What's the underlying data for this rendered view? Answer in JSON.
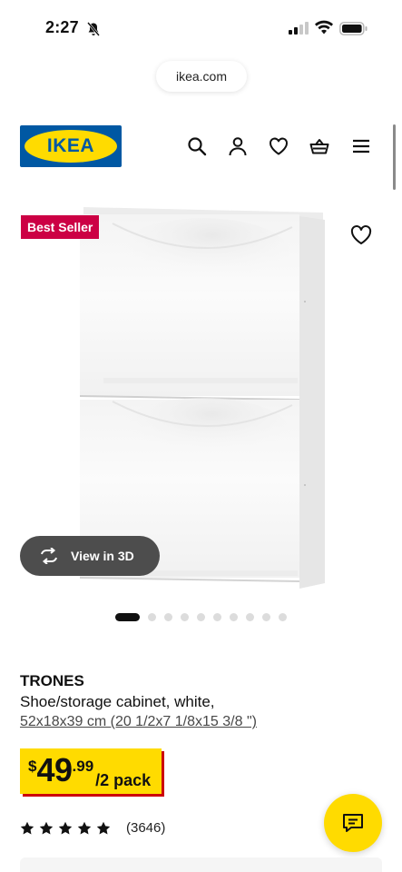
{
  "status_bar": {
    "time": "2:27"
  },
  "browser": {
    "url": "ikea.com"
  },
  "header": {
    "logo_text": "IKEA",
    "icons": [
      "search-icon",
      "account-icon",
      "favorites-icon",
      "basket-icon",
      "menu-icon"
    ]
  },
  "product": {
    "badge": "Best Seller",
    "view3d_label": "View in 3D",
    "carousel": {
      "total": 10,
      "active": 1
    },
    "name": "TRONES",
    "description": "Shoe/storage cabinet, white,",
    "dimensions": "52x18x39 cm (20 1/2x7 1/8x15 3/8 \")",
    "price": {
      "currency": "$",
      "integer": "49",
      "decimal": ".99",
      "unit": "/2 pack"
    },
    "rating": {
      "stars": 5,
      "count": "(3646)"
    }
  },
  "colors": {
    "ikea_blue": "#0058a3",
    "ikea_yellow": "#ffdb00",
    "badge_red": "#cc0044",
    "price_shadow": "#cc0008"
  }
}
